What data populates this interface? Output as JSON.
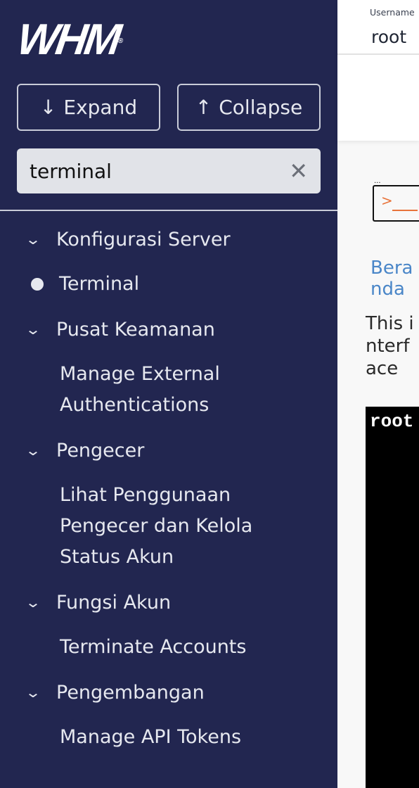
{
  "sidebar": {
    "logo": "WHM",
    "expand_label": "Expand",
    "collapse_label": "Collapse",
    "search_value": "terminal",
    "groups": [
      {
        "label": "Konfigurasi Server",
        "items": [
          "Terminal"
        ]
      },
      {
        "label": "Pusat Keamanan",
        "items": [
          "Manage External Authentications"
        ]
      },
      {
        "label": "Pengecer",
        "items": [
          "Lihat Penggunaan Pengecer dan Kelola Status Akun"
        ]
      },
      {
        "label": "Fungsi Akun",
        "items": [
          "Terminate Accounts"
        ]
      },
      {
        "label": "Pengembangan",
        "items": [
          "Manage API Tokens"
        ]
      }
    ]
  },
  "header": {
    "username_label": "Username",
    "username_value": "root"
  },
  "main": {
    "breadcrumb": "Beranda",
    "description": "This interface",
    "terminal_text": "root"
  }
}
